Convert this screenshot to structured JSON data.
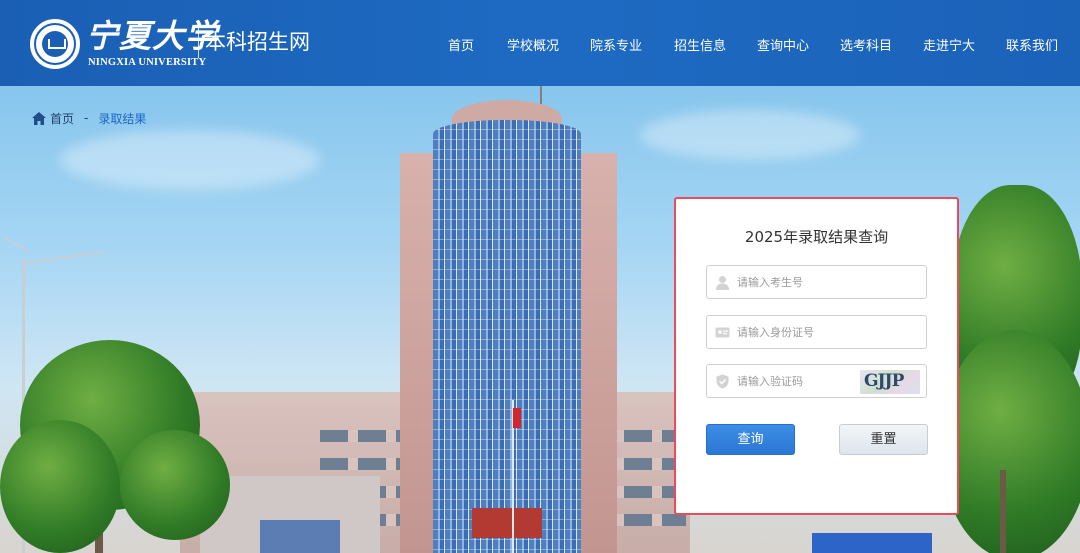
{
  "header": {
    "logo_cn": "宁夏大学",
    "logo_en": "NINGXIA UNIVERSITY",
    "site_name": "本科招生网",
    "nav": [
      {
        "label": "首页"
      },
      {
        "label": "学校概况"
      },
      {
        "label": "院系专业"
      },
      {
        "label": "招生信息"
      },
      {
        "label": "查询中心"
      },
      {
        "label": "选考科目"
      },
      {
        "label": "走进宁大"
      },
      {
        "label": "联系我们"
      }
    ]
  },
  "breadcrumb": {
    "home_icon": "home-icon",
    "home": "首页",
    "separator": "-",
    "current": "录取结果"
  },
  "query_panel": {
    "title": "2025年录取结果查询",
    "fields": {
      "exam_number": {
        "placeholder": "请输入考生号",
        "value": "",
        "icon": "user-icon"
      },
      "id_number": {
        "placeholder": "请输入身份证号",
        "value": "",
        "icon": "id-card-icon"
      },
      "captcha": {
        "placeholder": "请输入验证码",
        "value": "",
        "icon": "shield-icon",
        "captcha_text": "GJJP"
      }
    },
    "query_button": "查询",
    "reset_button": "重置"
  },
  "colors": {
    "header_blue": "#1a5fb4",
    "panel_border": "#ea4b5d",
    "query_button": "#2a77d4",
    "breadcrumb_current": "#1c67c6"
  }
}
